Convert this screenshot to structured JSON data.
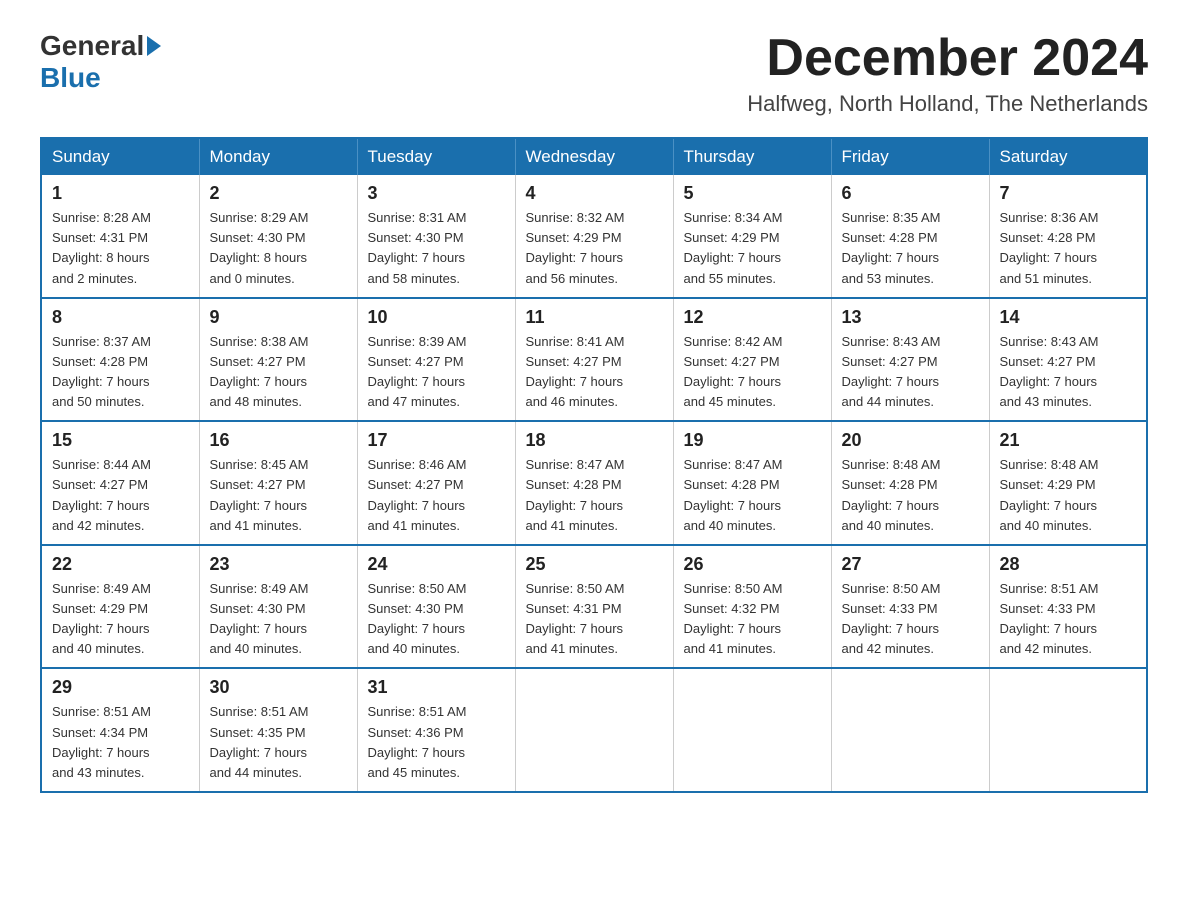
{
  "logo": {
    "general": "General",
    "blue": "Blue"
  },
  "title": "December 2024",
  "location": "Halfweg, North Holland, The Netherlands",
  "days_of_week": [
    "Sunday",
    "Monday",
    "Tuesday",
    "Wednesday",
    "Thursday",
    "Friday",
    "Saturday"
  ],
  "weeks": [
    [
      {
        "day": "1",
        "info": "Sunrise: 8:28 AM\nSunset: 4:31 PM\nDaylight: 8 hours\nand 2 minutes."
      },
      {
        "day": "2",
        "info": "Sunrise: 8:29 AM\nSunset: 4:30 PM\nDaylight: 8 hours\nand 0 minutes."
      },
      {
        "day": "3",
        "info": "Sunrise: 8:31 AM\nSunset: 4:30 PM\nDaylight: 7 hours\nand 58 minutes."
      },
      {
        "day": "4",
        "info": "Sunrise: 8:32 AM\nSunset: 4:29 PM\nDaylight: 7 hours\nand 56 minutes."
      },
      {
        "day": "5",
        "info": "Sunrise: 8:34 AM\nSunset: 4:29 PM\nDaylight: 7 hours\nand 55 minutes."
      },
      {
        "day": "6",
        "info": "Sunrise: 8:35 AM\nSunset: 4:28 PM\nDaylight: 7 hours\nand 53 minutes."
      },
      {
        "day": "7",
        "info": "Sunrise: 8:36 AM\nSunset: 4:28 PM\nDaylight: 7 hours\nand 51 minutes."
      }
    ],
    [
      {
        "day": "8",
        "info": "Sunrise: 8:37 AM\nSunset: 4:28 PM\nDaylight: 7 hours\nand 50 minutes."
      },
      {
        "day": "9",
        "info": "Sunrise: 8:38 AM\nSunset: 4:27 PM\nDaylight: 7 hours\nand 48 minutes."
      },
      {
        "day": "10",
        "info": "Sunrise: 8:39 AM\nSunset: 4:27 PM\nDaylight: 7 hours\nand 47 minutes."
      },
      {
        "day": "11",
        "info": "Sunrise: 8:41 AM\nSunset: 4:27 PM\nDaylight: 7 hours\nand 46 minutes."
      },
      {
        "day": "12",
        "info": "Sunrise: 8:42 AM\nSunset: 4:27 PM\nDaylight: 7 hours\nand 45 minutes."
      },
      {
        "day": "13",
        "info": "Sunrise: 8:43 AM\nSunset: 4:27 PM\nDaylight: 7 hours\nand 44 minutes."
      },
      {
        "day": "14",
        "info": "Sunrise: 8:43 AM\nSunset: 4:27 PM\nDaylight: 7 hours\nand 43 minutes."
      }
    ],
    [
      {
        "day": "15",
        "info": "Sunrise: 8:44 AM\nSunset: 4:27 PM\nDaylight: 7 hours\nand 42 minutes."
      },
      {
        "day": "16",
        "info": "Sunrise: 8:45 AM\nSunset: 4:27 PM\nDaylight: 7 hours\nand 41 minutes."
      },
      {
        "day": "17",
        "info": "Sunrise: 8:46 AM\nSunset: 4:27 PM\nDaylight: 7 hours\nand 41 minutes."
      },
      {
        "day": "18",
        "info": "Sunrise: 8:47 AM\nSunset: 4:28 PM\nDaylight: 7 hours\nand 41 minutes."
      },
      {
        "day": "19",
        "info": "Sunrise: 8:47 AM\nSunset: 4:28 PM\nDaylight: 7 hours\nand 40 minutes."
      },
      {
        "day": "20",
        "info": "Sunrise: 8:48 AM\nSunset: 4:28 PM\nDaylight: 7 hours\nand 40 minutes."
      },
      {
        "day": "21",
        "info": "Sunrise: 8:48 AM\nSunset: 4:29 PM\nDaylight: 7 hours\nand 40 minutes."
      }
    ],
    [
      {
        "day": "22",
        "info": "Sunrise: 8:49 AM\nSunset: 4:29 PM\nDaylight: 7 hours\nand 40 minutes."
      },
      {
        "day": "23",
        "info": "Sunrise: 8:49 AM\nSunset: 4:30 PM\nDaylight: 7 hours\nand 40 minutes."
      },
      {
        "day": "24",
        "info": "Sunrise: 8:50 AM\nSunset: 4:30 PM\nDaylight: 7 hours\nand 40 minutes."
      },
      {
        "day": "25",
        "info": "Sunrise: 8:50 AM\nSunset: 4:31 PM\nDaylight: 7 hours\nand 41 minutes."
      },
      {
        "day": "26",
        "info": "Sunrise: 8:50 AM\nSunset: 4:32 PM\nDaylight: 7 hours\nand 41 minutes."
      },
      {
        "day": "27",
        "info": "Sunrise: 8:50 AM\nSunset: 4:33 PM\nDaylight: 7 hours\nand 42 minutes."
      },
      {
        "day": "28",
        "info": "Sunrise: 8:51 AM\nSunset: 4:33 PM\nDaylight: 7 hours\nand 42 minutes."
      }
    ],
    [
      {
        "day": "29",
        "info": "Sunrise: 8:51 AM\nSunset: 4:34 PM\nDaylight: 7 hours\nand 43 minutes."
      },
      {
        "day": "30",
        "info": "Sunrise: 8:51 AM\nSunset: 4:35 PM\nDaylight: 7 hours\nand 44 minutes."
      },
      {
        "day": "31",
        "info": "Sunrise: 8:51 AM\nSunset: 4:36 PM\nDaylight: 7 hours\nand 45 minutes."
      },
      {
        "day": "",
        "info": ""
      },
      {
        "day": "",
        "info": ""
      },
      {
        "day": "",
        "info": ""
      },
      {
        "day": "",
        "info": ""
      }
    ]
  ]
}
